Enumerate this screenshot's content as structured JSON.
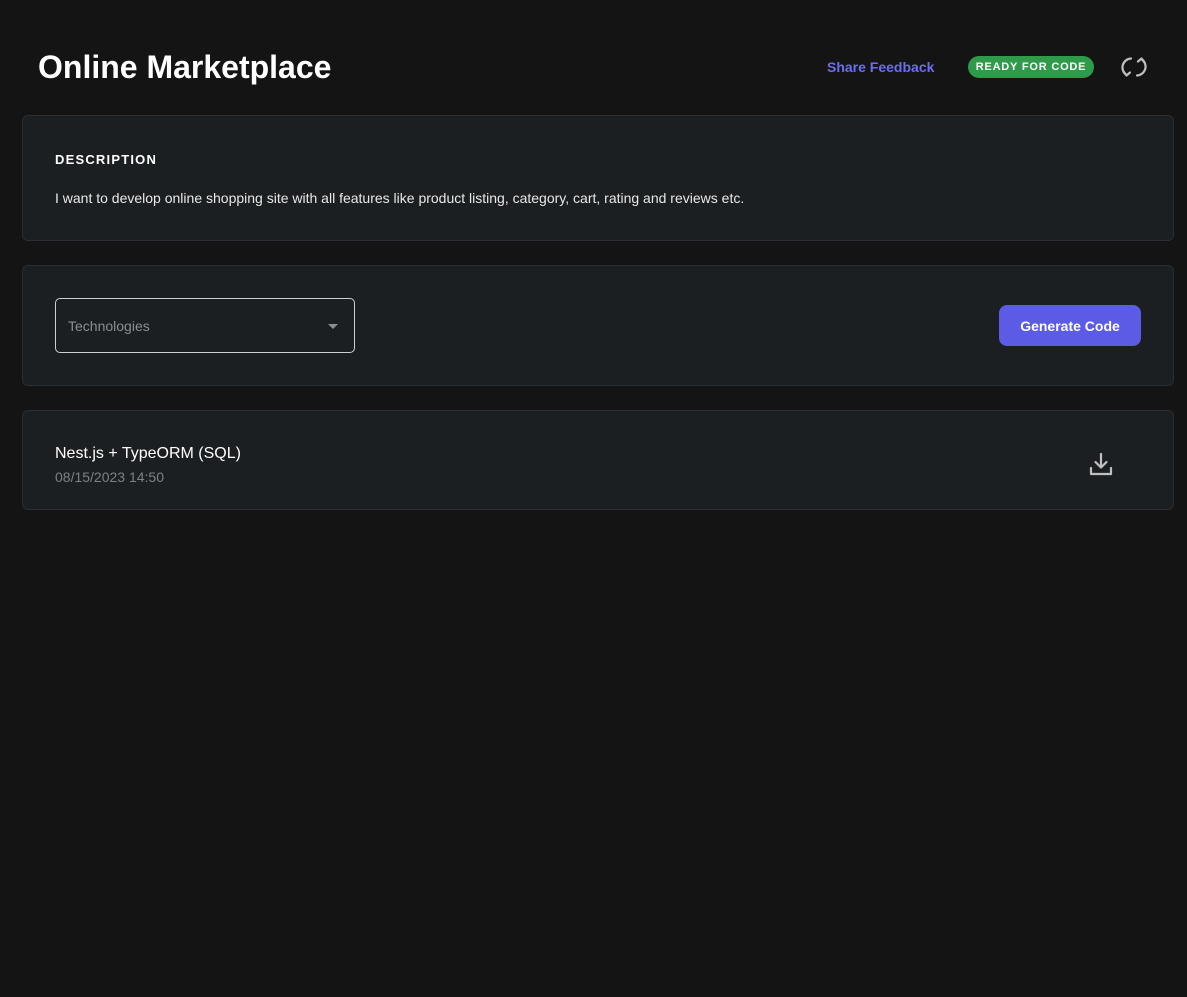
{
  "header": {
    "title": "Online Marketplace",
    "share_feedback_label": "Share Feedback",
    "status_badge": "READY FOR CODE",
    "refresh_icon": "refresh-icon"
  },
  "description": {
    "label": "DESCRIPTION",
    "text": "I want to develop online shopping site with all features like product listing, category, cart, rating and reviews etc."
  },
  "technologies": {
    "placeholder": "Technologies",
    "selected_value": "",
    "generate_label": "Generate Code"
  },
  "results": [
    {
      "title": "Nest.js + TypeORM (SQL)",
      "timestamp": "08/15/2023 14:50",
      "download_icon": "download-icon"
    }
  ],
  "colors": {
    "background": "#141414",
    "card": "#1c1f22",
    "accent": "#5b5be6",
    "link": "#6d6df0",
    "status_green": "#2e9a4a"
  }
}
